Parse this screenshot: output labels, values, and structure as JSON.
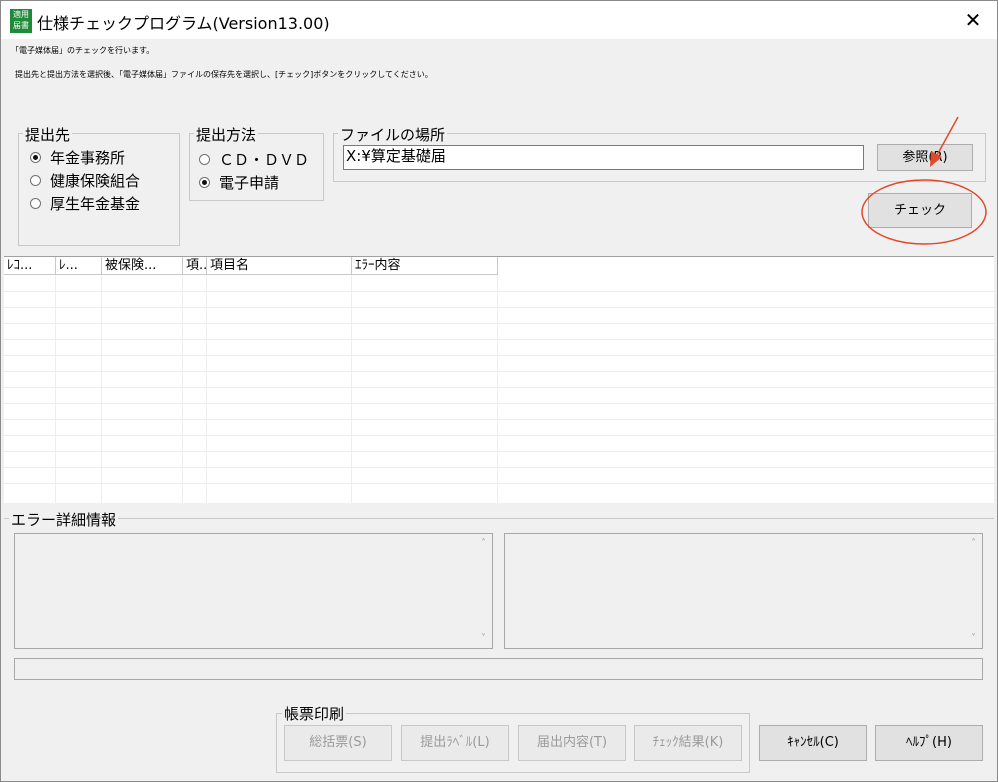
{
  "window": {
    "title": "仕様チェックプログラム(Version13.00)",
    "icon_text_line1": "適用",
    "icon_text_line2": "届書",
    "close_glyph": "✕"
  },
  "instructions": {
    "line1": "「電子媒体届」のチェックを行います。",
    "line2": "提出先と提出方法を選択後、「電子媒体届」ファイルの保存先を選択し、[チェック]ボタンをクリックしてください。"
  },
  "submission_target": {
    "label": "提出先",
    "options": [
      {
        "label": "年金事務所",
        "selected": true
      },
      {
        "label": "健康保険組合",
        "selected": false
      },
      {
        "label": "厚生年金基金",
        "selected": false
      }
    ]
  },
  "submission_method": {
    "label": "提出方法",
    "options": [
      {
        "label": "ＣＤ・ＤＶＤ",
        "selected": false
      },
      {
        "label": "電子申請",
        "selected": true
      }
    ]
  },
  "file_location": {
    "label": "ファイルの場所",
    "path_value": "X:¥算定基礎届",
    "browse_label": "参照(R)"
  },
  "check_button": {
    "label": "チェック"
  },
  "result_table": {
    "columns": [
      "ﾚｺ...",
      "ﾚ...",
      "被保険...",
      "項...",
      "項目名",
      "ｴﾗｰ内容"
    ]
  },
  "error_detail": {
    "label": "エラー詳細情報",
    "scroll_up": "˄",
    "scroll_down": "˅"
  },
  "report_print": {
    "label": "帳票印刷",
    "buttons": [
      "総括票(S)",
      "提出ﾗﾍﾞﾙ(L)",
      "届出内容(T)",
      "ﾁｪｯｸ結果(K)"
    ]
  },
  "footer": {
    "cancel_label": "ｷｬﾝｾﾙ(C)",
    "help_label": "ﾍﾙﾌﾟ(H)"
  },
  "annotation_color": "#e04a2a"
}
